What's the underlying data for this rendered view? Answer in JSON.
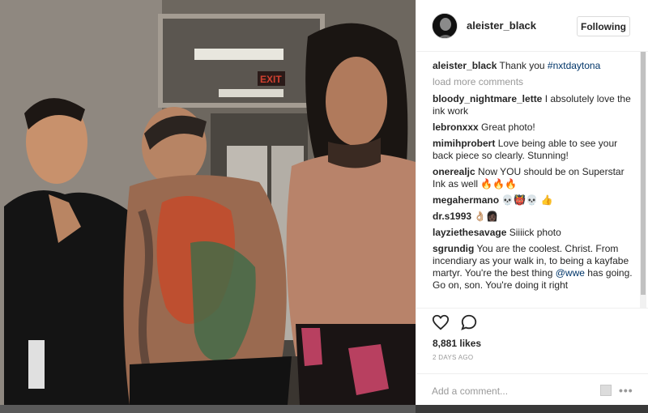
{
  "post": {
    "photo_label": "wrestlers-backstage-photo",
    "exit_sign": "EXIT"
  },
  "header": {
    "username": "aleister_black",
    "follow_label": "Following"
  },
  "caption": {
    "user": "aleister_black",
    "text": "Thank you ",
    "tag": "#nxtdaytona"
  },
  "load_more": "load more comments",
  "comments": [
    {
      "user": "bloody_nightmare_lette",
      "text": "I absolutely love the ink work"
    },
    {
      "user": "lebronxxx",
      "text": "Great photo!"
    },
    {
      "user": "mimihprobert",
      "text": "Love being able to see your back piece so clearly. Stunning!"
    },
    {
      "user": "onerealjc",
      "text": "Now YOU should be on Superstar Ink as well 🔥🔥🔥"
    },
    {
      "user": "megahermano",
      "text": "💀👹💀 👍"
    },
    {
      "user": "dr.s1993",
      "text": "👌🏼👩🏿"
    },
    {
      "user": "layziethesavage",
      "text": "Siiiick photo"
    },
    {
      "user": "sgrundig",
      "text": "You are the coolest. Christ. From incendiary as your walk in, to being a kayfabe martyr. You're the best thing ",
      "tag": "@wwe",
      "text2": " has going. Go on, son. You're doing it right"
    }
  ],
  "actions": {
    "like_icon": "heart-icon",
    "comment_icon": "comment-icon",
    "likes": "8,881 likes",
    "date": "2 DAYS AGO"
  },
  "add_comment": {
    "placeholder": "Add a comment...",
    "more": "•••"
  },
  "colors": {
    "link": "#003569",
    "muted": "#999999",
    "text": "#262626",
    "border": "#efefef"
  }
}
